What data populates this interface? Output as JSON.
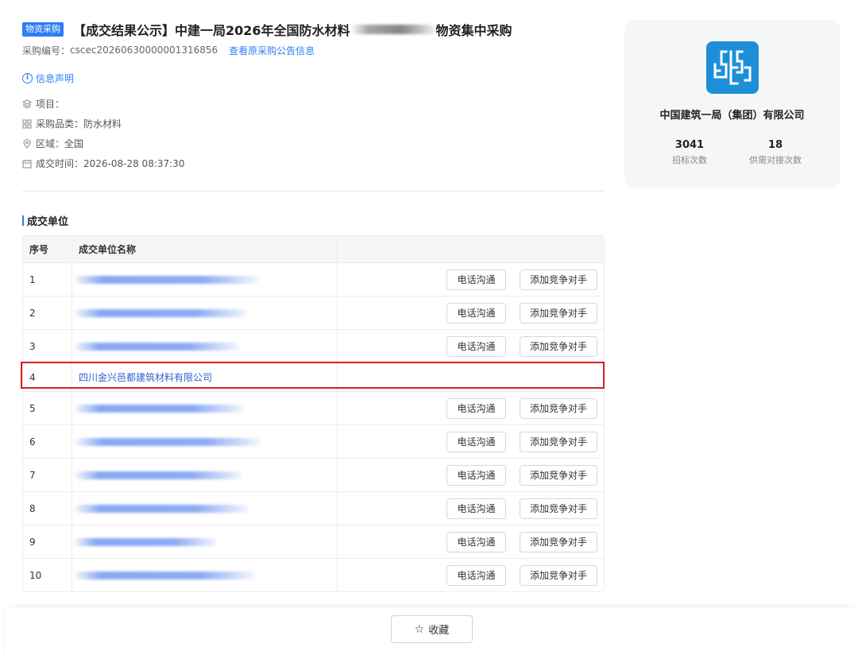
{
  "header": {
    "tag": "物资采购",
    "title": "【成交结果公示】中建一局2026年全国防水材料",
    "title_tail": "物资集中采购",
    "serial_label": "采购编号：",
    "serial_no": "cscec20260630000001316856",
    "view_original_link": "查看原采购公告信息",
    "declaration_link": "信息声明"
  },
  "attrs": {
    "project": "项目：",
    "category": "采购品类：防水材料",
    "region": "区域：全国",
    "deal_time": "成交时间：2026-08-28 08:37:30"
  },
  "section": {
    "title": "成交单位"
  },
  "table": {
    "col_index": "序号",
    "col_name": "成交单位名称",
    "call_label": "电话沟通",
    "add_label": "添加竞争对手",
    "rows": [
      {
        "index": "1"
      },
      {
        "index": "2"
      },
      {
        "index": "3"
      },
      {
        "index": "4",
        "name": "四川金兴邑都建筑材料有限公司"
      },
      {
        "index": "5"
      },
      {
        "index": "6"
      },
      {
        "index": "7"
      },
      {
        "index": "8"
      },
      {
        "index": "9"
      },
      {
        "index": "10"
      }
    ]
  },
  "card": {
    "company": "中国建筑一局（集团）有限公司",
    "bid_count": "3041",
    "bid_count_label": "招标次数",
    "supply_count": "18",
    "supply_count_label": "供需对接次数",
    "logo_color": "#1d8fd8"
  },
  "footer": {
    "favorite_label": "收藏"
  },
  "colors": {
    "accent": "#2f7df6",
    "highlight": "#d3201f"
  }
}
